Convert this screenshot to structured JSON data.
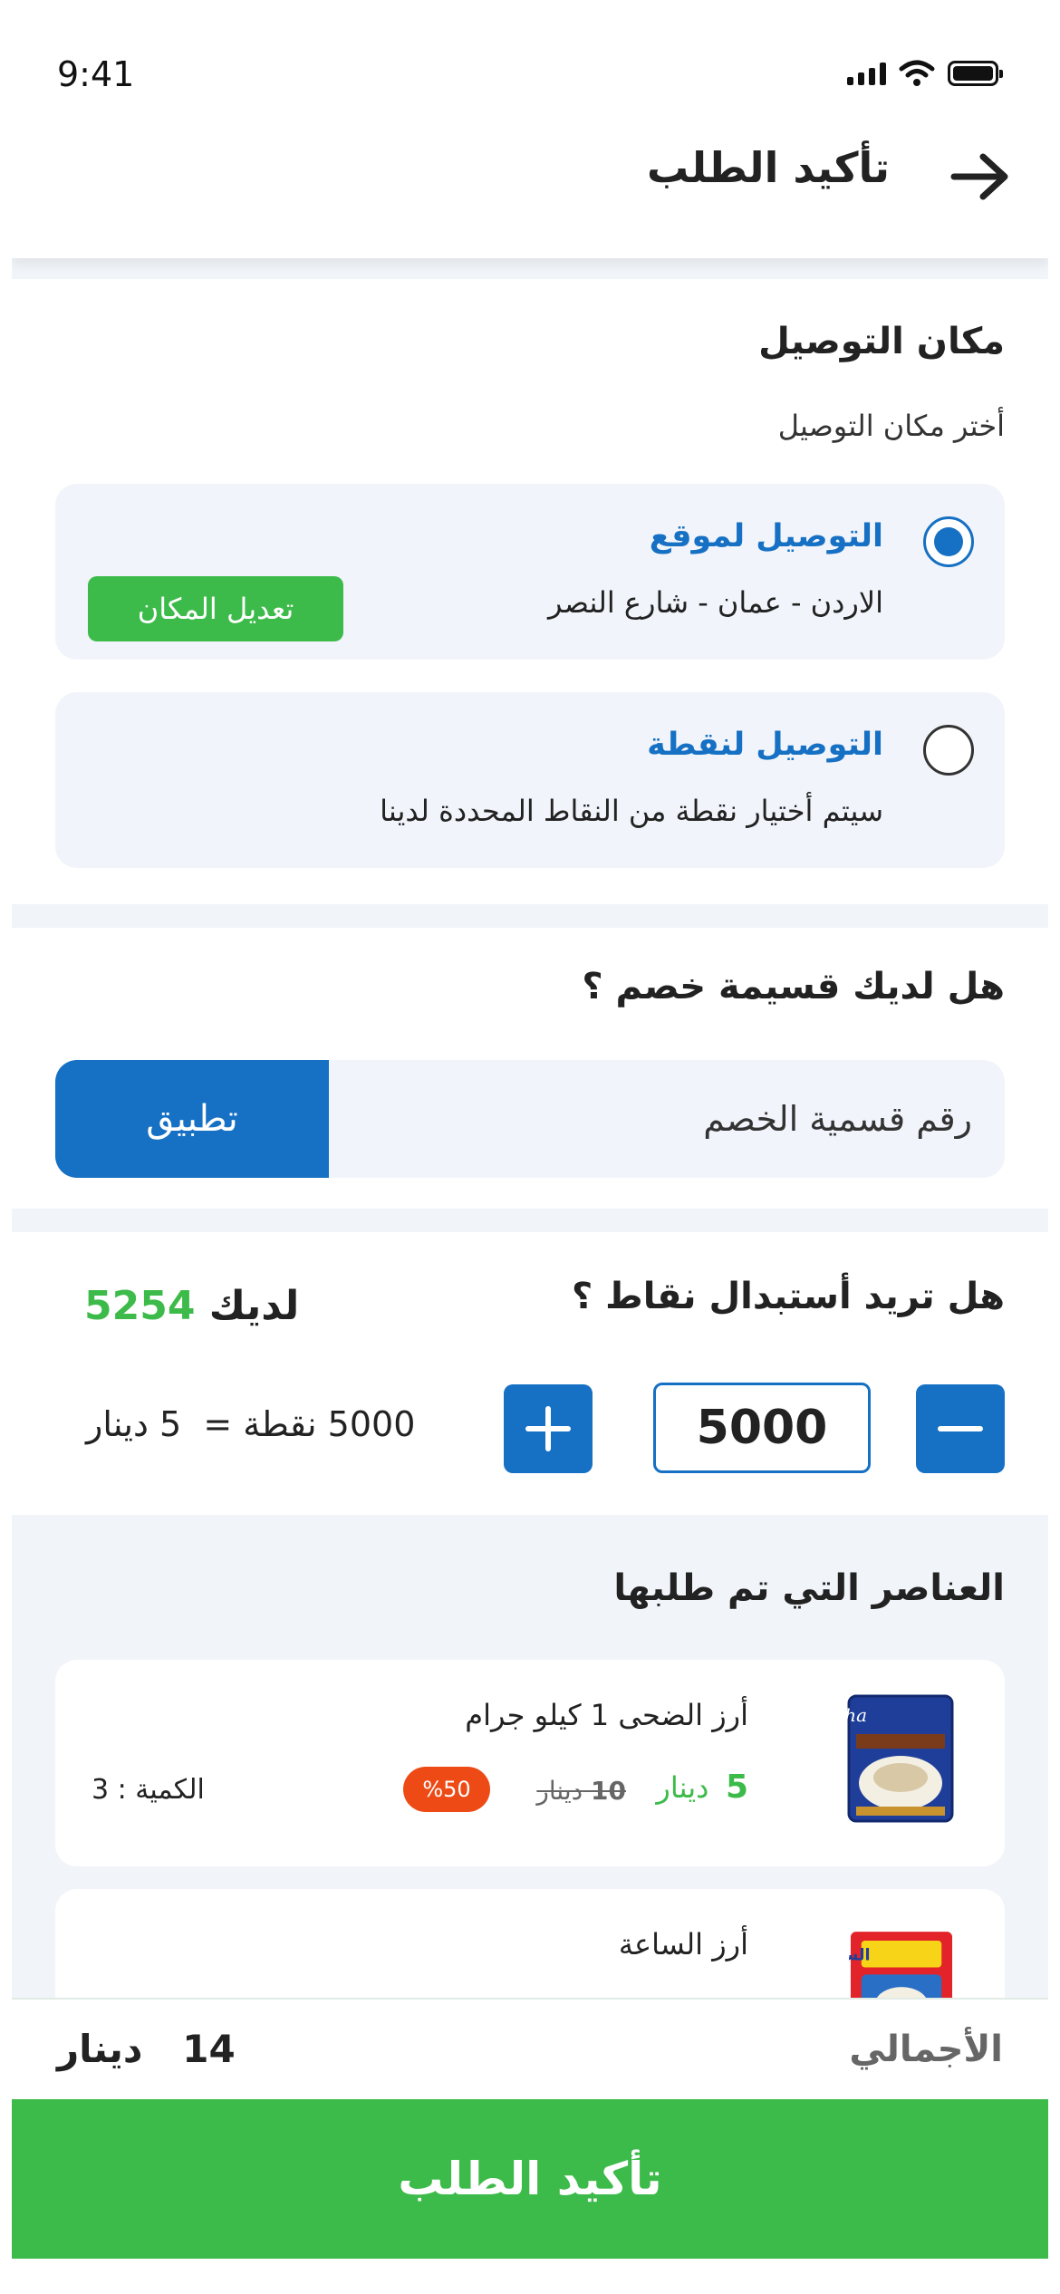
{
  "status_bar": {
    "time": "9:41"
  },
  "header": {
    "title": "تأكيد الطلب"
  },
  "delivery": {
    "title": "مكان التوصيل",
    "subtitle": "أختر مكان التوصيل",
    "options": [
      {
        "title": "التوصيل لموقع",
        "desc": "الاردن - عمان - شارع النصر",
        "selected": true,
        "edit_label": "تعديل المكان"
      },
      {
        "title": "التوصيل لنقطة",
        "desc": "سيتم أختيار نقطة من النقاط المحددة لدينا",
        "selected": false
      }
    ]
  },
  "coupon": {
    "title": "هل لديك قسيمة خصم ؟",
    "placeholder": "رقم قسمية الخصم",
    "apply_label": "تطبيق"
  },
  "points": {
    "title": "هل تريد أستبدال نقاط ؟",
    "have_label": "لديك",
    "have_value": "5254",
    "quantity": "5000",
    "equation": "5000 نقطة =  5 دينار"
  },
  "items": {
    "title": "العناصر التي تم طلبها",
    "list": [
      {
        "name": "أرز الضحى 1 كيلو جرام",
        "price": "5",
        "currency": "دينار",
        "old_price": "10",
        "old_currency": "دينار",
        "discount": "%50",
        "quantity_text": "الكمية : 3"
      },
      {
        "name": "أرز الساعة"
      }
    ]
  },
  "summary": {
    "total_label": "الأجمالي",
    "total_value": "14",
    "total_currency": "دينار",
    "confirm_label": "تأكيد الطلب"
  },
  "colors": {
    "primary": "#1670c3",
    "success": "#3dbb4a",
    "discount": "#ee4a16",
    "background": "#f1f4f9"
  },
  "icons": [
    "back-arrow-icon",
    "signal-icon",
    "wifi-icon",
    "battery-icon",
    "minus-icon",
    "plus-icon"
  ]
}
